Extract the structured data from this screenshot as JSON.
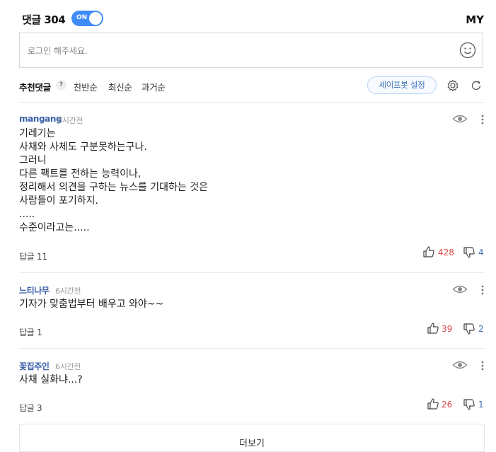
{
  "header": {
    "title": "댓글 304",
    "toggle_label": "ON",
    "my_label": "MY"
  },
  "login": {
    "placeholder": "로그인 해주세요."
  },
  "sort": {
    "tabs": [
      {
        "label": "추천댓글"
      },
      {
        "label": "찬반순"
      },
      {
        "label": "최신순"
      },
      {
        "label": "과거순"
      }
    ],
    "help": "?",
    "safebot_label": "세이프봇 설정"
  },
  "colors": {
    "accent": "#3f8cf8",
    "author": "#3a5fa8",
    "like": "#e04848",
    "dislike": "#3a6fb5"
  },
  "comments": [
    {
      "author": "mangang",
      "time": "6시간전",
      "body": "기레기는\n사채와 사체도 구분못하는구나.\n그러니\n다른 팩트를 전하는 능력이나,\n정리해서 의견을 구하는 뉴스를 기대하는 것은\n사람들이 포기하지.\n.....\n수준이라고는.....",
      "reply_label": "답글",
      "reply_count": "11",
      "likes": "428",
      "dislikes": "4"
    },
    {
      "author": "느티나무",
      "time": "6시간전",
      "body": "기자가 맞춤법부터 배우고 와야~~",
      "reply_label": "답글",
      "reply_count": "1",
      "likes": "39",
      "dislikes": "2"
    },
    {
      "author": "꽃집주인",
      "time": "6시간전",
      "body": "사채 실화냐...?",
      "reply_label": "답글",
      "reply_count": "3",
      "likes": "26",
      "dislikes": "1"
    }
  ],
  "more": {
    "label": "더보기"
  }
}
